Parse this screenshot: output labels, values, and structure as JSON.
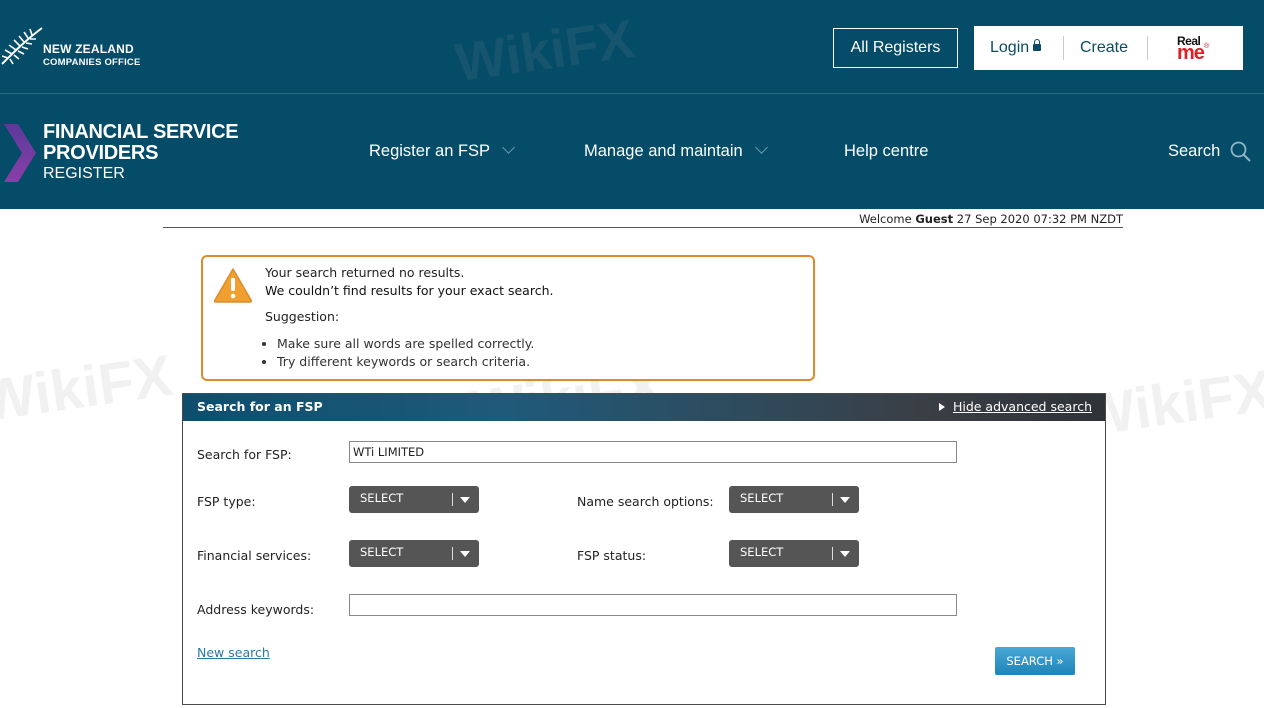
{
  "header": {
    "logo_line1": "NEW ZEALAND",
    "logo_line2": "COMPANIES OFFICE",
    "all_registers": "All Registers",
    "login": "Login",
    "create": "Create",
    "realme_top": "Real",
    "realme_bottom": "me",
    "realme_mark": "®",
    "brand_line1": "FINANCIAL SERVICE",
    "brand_line2": "PROVIDERS",
    "brand_line3": "REGISTER",
    "nav": [
      {
        "label": "Register an FSP"
      },
      {
        "label": "Manage and maintain"
      },
      {
        "label": "Help centre"
      },
      {
        "label": "Search"
      }
    ]
  },
  "welcome": {
    "prefix": "Welcome",
    "user": "Guest",
    "datetime": "27 Sep 2020 07:32 PM NZDT"
  },
  "alert": {
    "line1": "Your search returned no results.",
    "line2": "We couldn’t find results for your exact search.",
    "suggestion_label": "Suggestion:",
    "suggestions": [
      "Make sure all words are spelled correctly.",
      "Try different keywords or search criteria."
    ]
  },
  "search_panel": {
    "title": "Search for an FSP",
    "hide_advanced": "Hide advanced search",
    "search_for_label": "Search for FSP:",
    "search_for_value": "WTi LIMITED",
    "fsp_type_label": "FSP type:",
    "fsp_type_value": "SELECT",
    "name_options_label": "Name search options:",
    "name_options_value": "SELECT",
    "financial_services_label": "Financial services:",
    "financial_services_value": "SELECT",
    "fsp_status_label": "FSP status:",
    "fsp_status_value": "SELECT",
    "address_label": "Address keywords:",
    "address_value": "",
    "new_search": "New search",
    "search_button": "SEARCH »"
  },
  "watermark": "WikiFX",
  "colors": {
    "header_bg": "#044c68",
    "alert_border": "#e08a2c",
    "search_button": "#2a93c6",
    "link": "#2a7aa6",
    "brand_chevron": "#6b3fa0"
  }
}
